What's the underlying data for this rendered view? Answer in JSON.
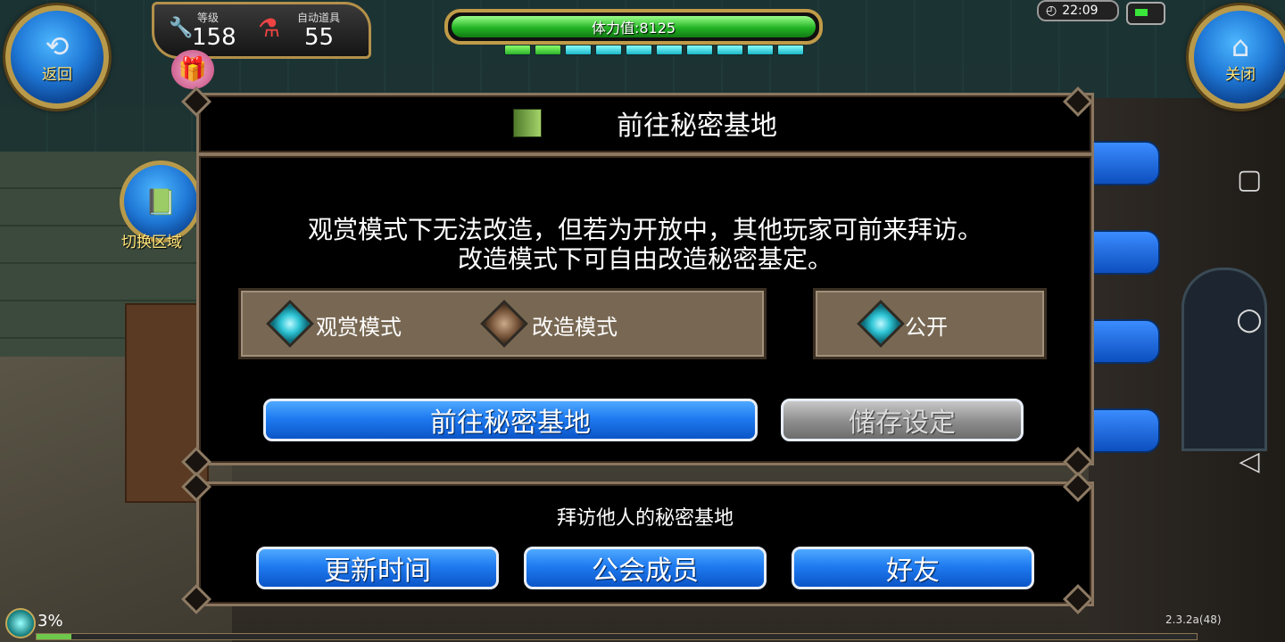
{
  "hud": {
    "back_label": "返回",
    "close_label": "关闭",
    "level_key": "等级",
    "level_value": "158",
    "auto_item_key": "自动道具",
    "auto_item_value": "55",
    "stamina_text": "体力值:8125",
    "stamina_fraction": 0.98,
    "energy_segments": [
      "green",
      "green",
      "cyan",
      "cyan",
      "cyan",
      "cyan",
      "cyan",
      "cyan",
      "cyan",
      "cyan"
    ],
    "clock": "22:09",
    "switch_area_label": "切换区域",
    "exp_percent": "3%",
    "exp_fraction": 0.03,
    "version": "2.3.2a(48)"
  },
  "dialog": {
    "title": "前往秘密基地",
    "description_line1": "观赏模式下无法改造，但若为开放中，其他玩家可前来拜访。",
    "description_line2": "改造模式下可自由改造秘密基定。",
    "mode_options": [
      {
        "label": "观赏模式",
        "selected": true
      },
      {
        "label": "改造模式",
        "selected": false
      }
    ],
    "public_option": {
      "label": "公开",
      "selected": true
    },
    "go_button": "前往秘密基地",
    "save_button": "储存设定"
  },
  "visit": {
    "title": "拜访他人的秘密基地",
    "buttons": [
      "更新时间",
      "公会成员",
      "好友"
    ]
  },
  "colors": {
    "accent_blue": "#1f7bf0",
    "frame_gold": "#b89a4a",
    "stamina_green": "#23b325",
    "gem_cyan": "#30c6d6"
  }
}
